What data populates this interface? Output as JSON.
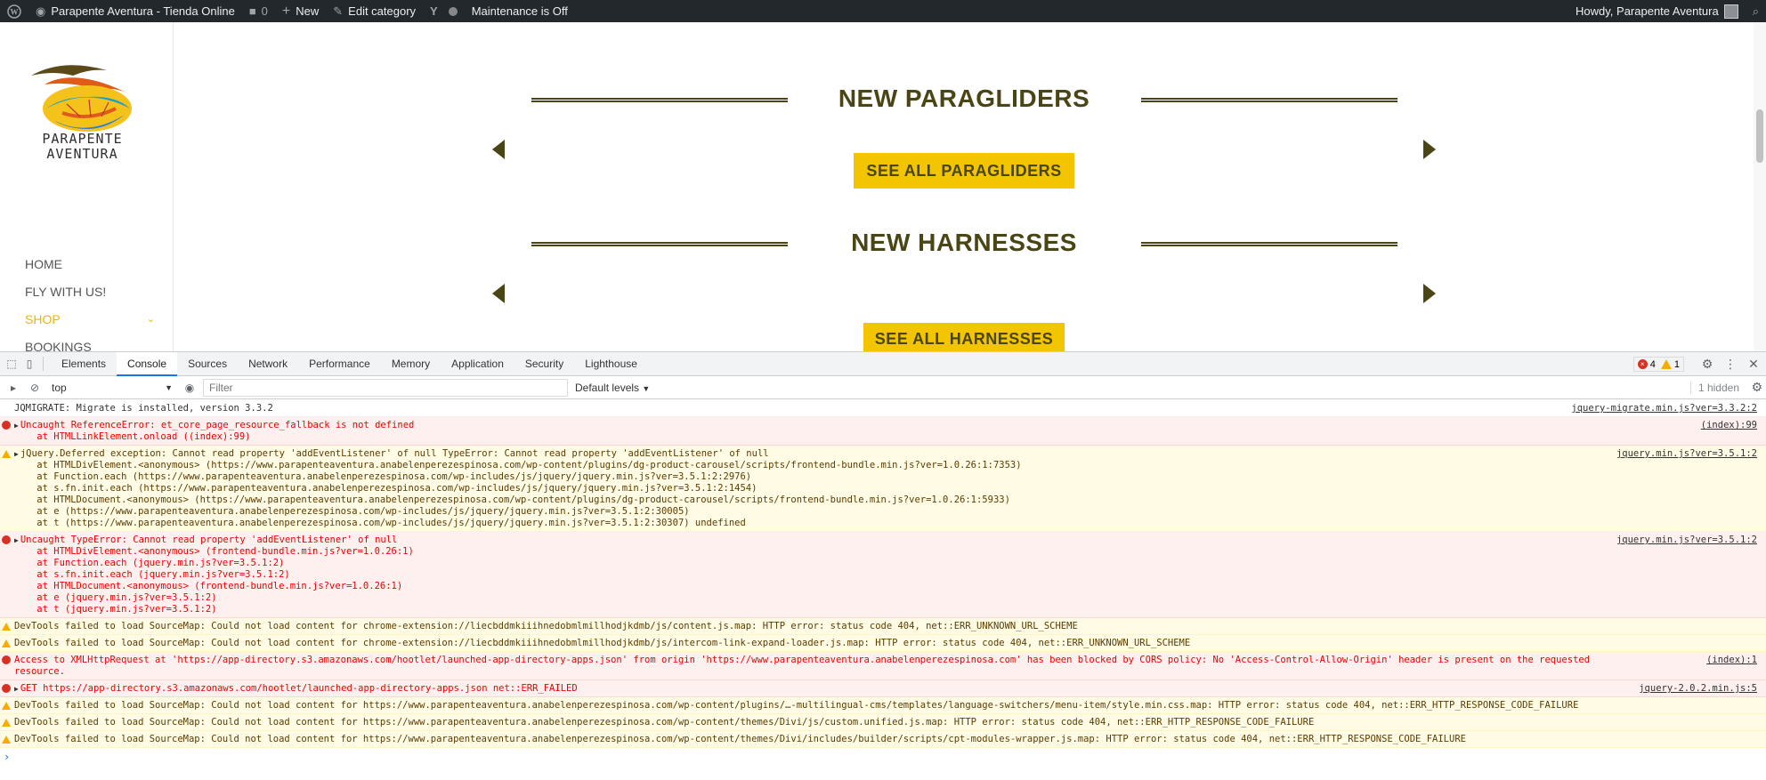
{
  "adminbar": {
    "site_name": "Parapente Aventura - Tienda Online",
    "comments_count": "0",
    "new_label": "New",
    "edit_label": "Edit category",
    "maintenance": "Maintenance is Off",
    "howdy": "Howdy, Parapente Aventura"
  },
  "site": {
    "logo_text_line1": "PARAPENTE",
    "logo_text_line2": "AVENTURA",
    "nav": [
      {
        "label": "HOME"
      },
      {
        "label": "FLY WITH US!"
      },
      {
        "label": "SHOP"
      },
      {
        "label": "BOOKINGS"
      }
    ],
    "sections": [
      {
        "title": "NEW PARAGLIDERS",
        "cta": "SEE ALL PARAGLIDERS"
      },
      {
        "title": "NEW HARNESSES",
        "cta": "SEE ALL HARNESSES"
      }
    ],
    "colors": {
      "accent": "#f2c500",
      "heading": "#4a4514"
    }
  },
  "devtools": {
    "tabs": [
      "Elements",
      "Console",
      "Sources",
      "Network",
      "Performance",
      "Memory",
      "Application",
      "Security",
      "Lighthouse"
    ],
    "active_tab": "Console",
    "error_count": "4",
    "warning_count": "1",
    "context": "top",
    "filter_placeholder": "Filter",
    "levels": "Default levels",
    "hidden": "1 hidden"
  },
  "console": {
    "messages": [
      {
        "level": "info",
        "text": "JQMIGRATE: Migrate is installed, version 3.3.2",
        "source": "jquery-migrate.min.js?ver=3.3.2:2"
      },
      {
        "level": "error",
        "text": "Uncaught ReferenceError: et_core_page_resource_fallback is not defined",
        "stack": "    at HTMLLinkElement.onload ((index):99)",
        "source": "(index):99"
      },
      {
        "level": "warning",
        "text": "jQuery.Deferred exception: Cannot read property 'addEventListener' of null TypeError: Cannot read property 'addEventListener' of null",
        "stack": "    at HTMLDivElement.<anonymous> (https://www.parapenteaventura.anabelenperezespinosa.com/wp-content/plugins/dg-product-carousel/scripts/frontend-bundle.min.js?ver=1.0.26:1:7353)\n    at Function.each (https://www.parapenteaventura.anabelenperezespinosa.com/wp-includes/js/jquery/jquery.min.js?ver=3.5.1:2:2976)\n    at s.fn.init.each (https://www.parapenteaventura.anabelenperezespinosa.com/wp-includes/js/jquery/jquery.min.js?ver=3.5.1:2:1454)\n    at HTMLDocument.<anonymous> (https://www.parapenteaventura.anabelenperezespinosa.com/wp-content/plugins/dg-product-carousel/scripts/frontend-bundle.min.js?ver=1.0.26:1:5933)\n    at e (https://www.parapenteaventura.anabelenperezespinosa.com/wp-includes/js/jquery/jquery.min.js?ver=3.5.1:2:30005)\n    at t (https://www.parapenteaventura.anabelenperezespinosa.com/wp-includes/js/jquery/jquery.min.js?ver=3.5.1:2:30307) undefined",
        "source": "jquery.min.js?ver=3.5.1:2"
      },
      {
        "level": "error",
        "text": "Uncaught TypeError: Cannot read property 'addEventListener' of null",
        "stack": "    at HTMLDivElement.<anonymous> (frontend-bundle.min.js?ver=1.0.26:1)\n    at Function.each (jquery.min.js?ver=3.5.1:2)\n    at s.fn.init.each (jquery.min.js?ver=3.5.1:2)\n    at HTMLDocument.<anonymous> (frontend-bundle.min.js?ver=1.0.26:1)\n    at e (jquery.min.js?ver=3.5.1:2)\n    at t (jquery.min.js?ver=3.5.1:2)",
        "source": "jquery.min.js?ver=3.5.1:2"
      },
      {
        "level": "warning",
        "text": "DevTools failed to load SourceMap: Could not load content for chrome-extension://liecbddmkiiihnedobmlmillhodjkdmb/js/content.js.map: HTTP error: status code 404, net::ERR_UNKNOWN_URL_SCHEME",
        "source": ""
      },
      {
        "level": "warning",
        "text": "DevTools failed to load SourceMap: Could not load content for chrome-extension://liecbddmkiiihnedobmlmillhodjkdmb/js/intercom-link-expand-loader.js.map: HTTP error: status code 404, net::ERR_UNKNOWN_URL_SCHEME",
        "source": ""
      },
      {
        "level": "error",
        "text": "Access to XMLHttpRequest at 'https://app-directory.s3.amazonaws.com/hootlet/launched-app-directory-apps.json' from origin 'https://www.parapenteaventura.anabelenperezespinosa.com' has been blocked by CORS policy: No 'Access-Control-Allow-Origin' header is present on the requested\nresource.",
        "source": "(index):1"
      },
      {
        "level": "error",
        "text": "GET https://app-directory.s3.amazonaws.com/hootlet/launched-app-directory-apps.json net::ERR_FAILED",
        "source": "jquery-2.0.2.min.js:5"
      },
      {
        "level": "warning",
        "text": "DevTools failed to load SourceMap: Could not load content for https://www.parapenteaventura.anabelenperezespinosa.com/wp-content/plugins/…-multilingual-cms/templates/language-switchers/menu-item/style.min.css.map: HTTP error: status code 404, net::ERR_HTTP_RESPONSE_CODE_FAILURE",
        "source": ""
      },
      {
        "level": "warning",
        "text": "DevTools failed to load SourceMap: Could not load content for https://www.parapenteaventura.anabelenperezespinosa.com/wp-content/themes/Divi/js/custom.unified.js.map: HTTP error: status code 404, net::ERR_HTTP_RESPONSE_CODE_FAILURE",
        "source": ""
      },
      {
        "level": "warning",
        "text": "DevTools failed to load SourceMap: Could not load content for https://www.parapenteaventura.anabelenperezespinosa.com/wp-content/themes/Divi/includes/builder/scripts/cpt-modules-wrapper.js.map: HTTP error: status code 404, net::ERR_HTTP_RESPONSE_CODE_FAILURE",
        "source": ""
      }
    ],
    "prompt": "›"
  }
}
